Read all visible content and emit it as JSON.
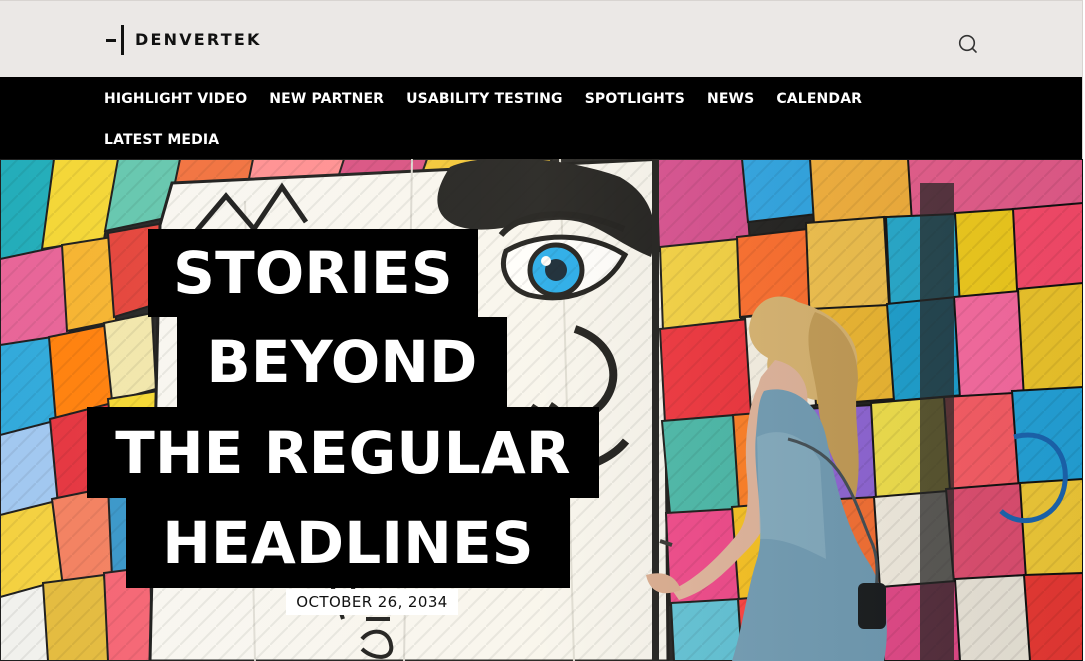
{
  "header": {
    "brand": "DENVERTEK",
    "logo_icon": "denvertek-logo-mark",
    "search_icon": "search-icon",
    "background": "#ebe8e6"
  },
  "navigation": {
    "background": "#000000",
    "items": [
      {
        "label": "HIGHLIGHT VIDEO"
      },
      {
        "label": "NEW PARTNER"
      },
      {
        "label": "USABILITY TESTING"
      },
      {
        "label": "SPOTLIGHTS"
      },
      {
        "label": "NEWS"
      },
      {
        "label": "CALENDAR"
      },
      {
        "label": "LATEST MEDIA"
      }
    ]
  },
  "hero": {
    "headline_lines": [
      "STORIES",
      "BEYOND",
      "THE REGULAR",
      "HEADLINES"
    ],
    "date": "OCTOBER 26, 2034",
    "image": {
      "subject": "woman walking past a poster-covered street art wall",
      "colors": {
        "wall_white": "#f7f5ef",
        "eye_blue": "#1ca4e8",
        "poster_red": "#e72f2f",
        "poster_orange": "#f28c1b",
        "poster_yellow": "#f5cf24",
        "poster_pink": "#f05a9b",
        "poster_teal": "#48b6b0",
        "dress_blue": "#6e9bb5"
      }
    }
  }
}
